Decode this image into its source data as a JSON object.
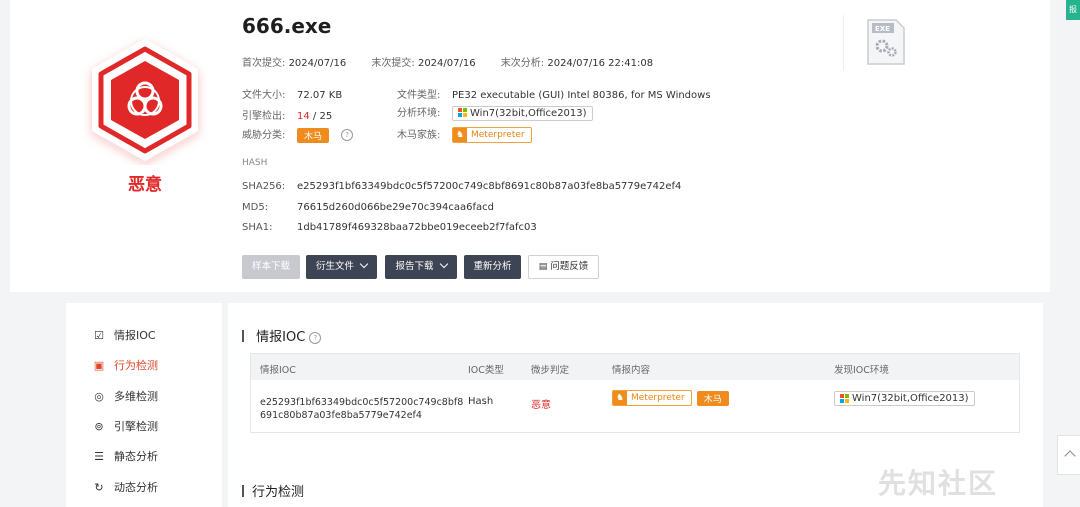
{
  "file": {
    "name": "666.exe",
    "verdict": "恶意",
    "first_submit_label": "首次提交:",
    "first_submit": "2024/07/16",
    "last_submit_label": "末次提交:",
    "last_submit": "2024/07/16",
    "last_analysis_label": "末次分析:",
    "last_analysis": "2024/07/16 22:41:08",
    "size_label": "文件大小:",
    "size": "72.07 KB",
    "type_label": "文件类型:",
    "type": "PE32 executable (GUI) Intel 80386, for MS Windows",
    "engine_label": "引擎检出:",
    "engine_detected": "14",
    "engine_total": " / 25",
    "env_label": "分析环境:",
    "env": "Win7(32bit,Office2013)",
    "threat_label": "威胁分类:",
    "threat": "木马",
    "family_label": "木马家族:",
    "family": "Meterpreter",
    "exe_icon_text": "EXE"
  },
  "hash": {
    "title": "HASH",
    "sha256_label": "SHA256:",
    "sha256": "e25293f1bf63349bdc0c5f57200c749c8bf8691c80b87a03fe8ba5779e742ef4",
    "md5_label": "MD5:",
    "md5": "76615d260d066be29e70c394caa6facd",
    "sha1_label": "SHA1:",
    "sha1": "1db41789f469328baa72bbe019eceeb2f7fafc03"
  },
  "actions": {
    "sample_download": "样本下载",
    "derived_files": "衍生文件",
    "report_download": "报告下载",
    "reanalyze": "重新分析",
    "feedback": "问题反馈"
  },
  "nav": {
    "items": [
      {
        "label": "情报IOC",
        "icon": "document-check-icon"
      },
      {
        "label": "行为检测",
        "icon": "monitor-icon"
      },
      {
        "label": "多维检测",
        "icon": "radar-icon"
      },
      {
        "label": "引擎检测",
        "icon": "engine-icon"
      },
      {
        "label": "静态分析",
        "icon": "list-icon"
      },
      {
        "label": "动态分析",
        "icon": "refresh-icon"
      }
    ]
  },
  "ioc_section": {
    "title": "情报IOC",
    "headers": [
      "情报IOC",
      "IOC类型",
      "微步判定",
      "情报内容",
      "发现IOC环境"
    ],
    "row": {
      "ioc_line1": "e25293f1bf63349bdc0c5f57200c749c8bf8",
      "ioc_line2": "691c80b87a03fe8ba5779e742ef4",
      "type": "Hash",
      "verdict": "恶意",
      "family_tag": "Meterpreter",
      "threat_tag": "木马",
      "env": "Win7(32bit,Office2013)"
    }
  },
  "behavior_section": {
    "title": "行为检测"
  },
  "corner_tag": "报",
  "watermark": "先知社区",
  "colors": {
    "malicious": "#e02828",
    "accent_orange": "#f08c1e",
    "button_dark": "#3d4453"
  }
}
